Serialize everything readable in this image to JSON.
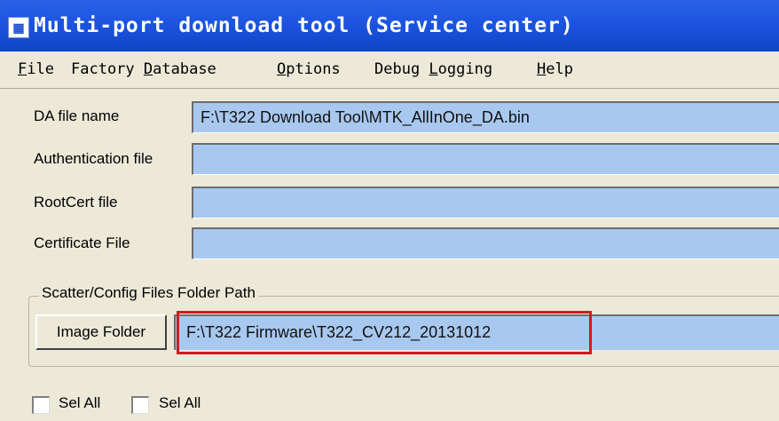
{
  "window": {
    "title": "Multi-port download tool (Service center)",
    "icon": "app-icon"
  },
  "menu": [
    {
      "pre": "",
      "u": "F",
      "post": "ile"
    },
    {
      "pre": "Factory ",
      "u": "D",
      "post": "atabase"
    },
    {
      "pre": "",
      "u": "O",
      "post": "ptions"
    },
    {
      "pre": "Debug ",
      "u": "L",
      "post": "ogging"
    },
    {
      "pre": "",
      "u": "H",
      "post": "elp"
    }
  ],
  "fields": {
    "da": {
      "label": "DA file name",
      "value": "F:\\T322 Download Tool\\MTK_AllInOne_DA.bin"
    },
    "auth": {
      "label": "Authentication file",
      "value": ""
    },
    "rootcert": {
      "label": "RootCert file",
      "value": ""
    },
    "cert": {
      "label": "Certificate File",
      "value": ""
    }
  },
  "scatter": {
    "group_label": "Scatter/Config Files Folder Path",
    "button_label": "Image Folder",
    "path_value": "F:\\T322 Firmware\\T322_CV212_20131012"
  },
  "select_all": [
    {
      "label": "Sel All",
      "checked": false
    },
    {
      "label": "Sel All",
      "checked": false
    }
  ],
  "colors": {
    "titlebar": "#1c54e0",
    "field_bg": "#a8c8ef",
    "highlight": "#d2191f",
    "window_bg": "#ece9d8"
  }
}
